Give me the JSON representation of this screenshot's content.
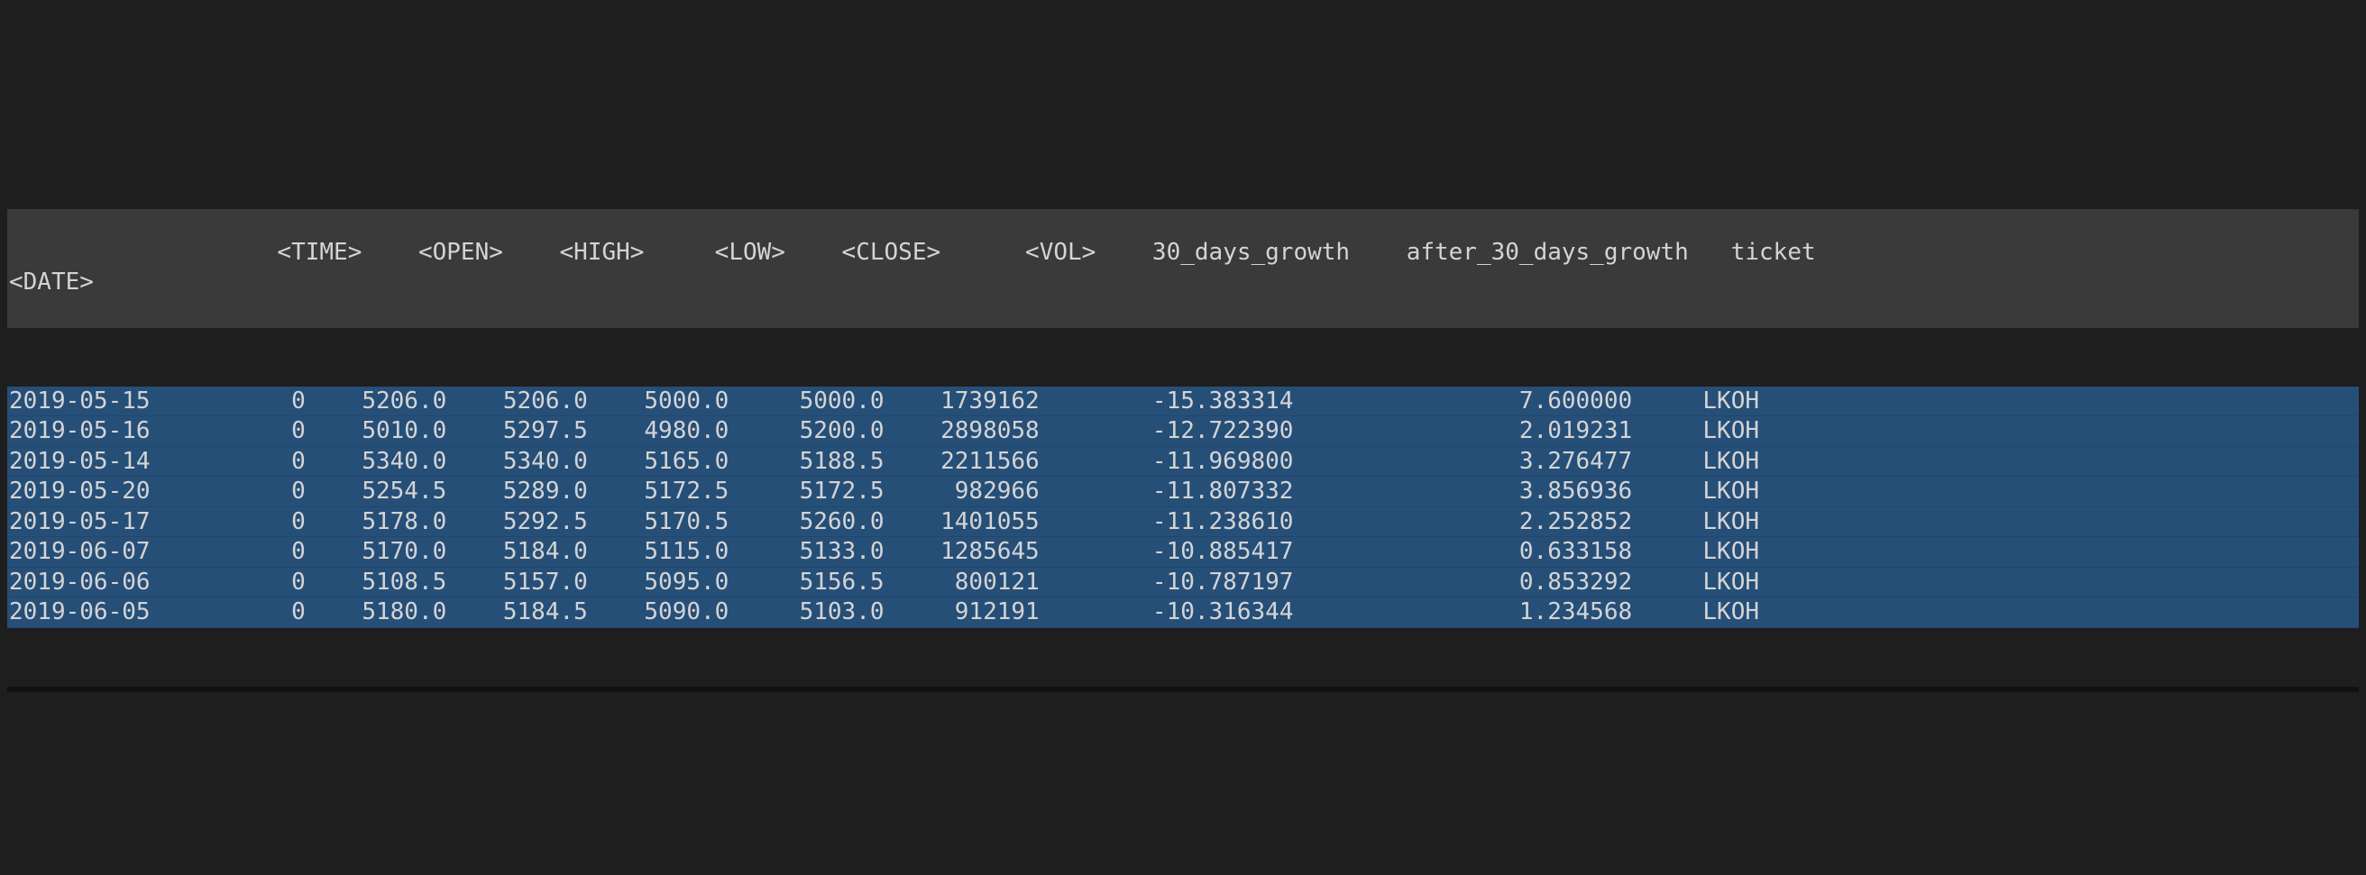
{
  "index_label": "<DATE>",
  "columns": [
    "<TIME>",
    "<OPEN>",
    "<HIGH>",
    "<LOW>",
    "<CLOSE>",
    "<VOL>",
    "30_days_growth",
    "after_30_days_growth",
    "ticket"
  ],
  "col_widths": {
    "index": 11,
    "<TIME>": 8,
    "<OPEN>": 8,
    "<HIGH>": 8,
    "<LOW>": 8,
    "<CLOSE>": 9,
    "<VOL>": 9,
    "30_days_growth": 16,
    "after_30_days_growth": 22,
    "ticket": 7
  },
  "rows": [
    {
      "date": "2019-05-15",
      "time": "0",
      "open": "5206.0",
      "high": "5206.0",
      "low": "5000.0",
      "close": "5000.0",
      "vol": "1739162",
      "g30": "-15.383314",
      "ag30": "7.600000",
      "ticket": "LKOH"
    },
    {
      "date": "2019-05-16",
      "time": "0",
      "open": "5010.0",
      "high": "5297.5",
      "low": "4980.0",
      "close": "5200.0",
      "vol": "2898058",
      "g30": "-12.722390",
      "ag30": "2.019231",
      "ticket": "LKOH"
    },
    {
      "date": "2019-05-14",
      "time": "0",
      "open": "5340.0",
      "high": "5340.0",
      "low": "5165.0",
      "close": "5188.5",
      "vol": "2211566",
      "g30": "-11.969800",
      "ag30": "3.276477",
      "ticket": "LKOH"
    },
    {
      "date": "2019-05-20",
      "time": "0",
      "open": "5254.5",
      "high": "5289.0",
      "low": "5172.5",
      "close": "5172.5",
      "vol": "982966",
      "g30": "-11.807332",
      "ag30": "3.856936",
      "ticket": "LKOH"
    },
    {
      "date": "2019-05-17",
      "time": "0",
      "open": "5178.0",
      "high": "5292.5",
      "low": "5170.5",
      "close": "5260.0",
      "vol": "1401055",
      "g30": "-11.238610",
      "ag30": "2.252852",
      "ticket": "LKOH"
    },
    {
      "date": "2019-06-07",
      "time": "0",
      "open": "5170.0",
      "high": "5184.0",
      "low": "5115.0",
      "close": "5133.0",
      "vol": "1285645",
      "g30": "-10.885417",
      "ag30": "0.633158",
      "ticket": "LKOH"
    },
    {
      "date": "2019-06-06",
      "time": "0",
      "open": "5108.5",
      "high": "5157.0",
      "low": "5095.0",
      "close": "5156.5",
      "vol": "800121",
      "g30": "-10.787197",
      "ag30": "0.853292",
      "ticket": "LKOH"
    },
    {
      "date": "2019-06-05",
      "time": "0",
      "open": "5180.0",
      "high": "5184.5",
      "low": "5090.0",
      "close": "5103.0",
      "vol": "912191",
      "g30": "-10.316344",
      "ag30": "1.234568",
      "ticket": "LKOH"
    }
  ]
}
